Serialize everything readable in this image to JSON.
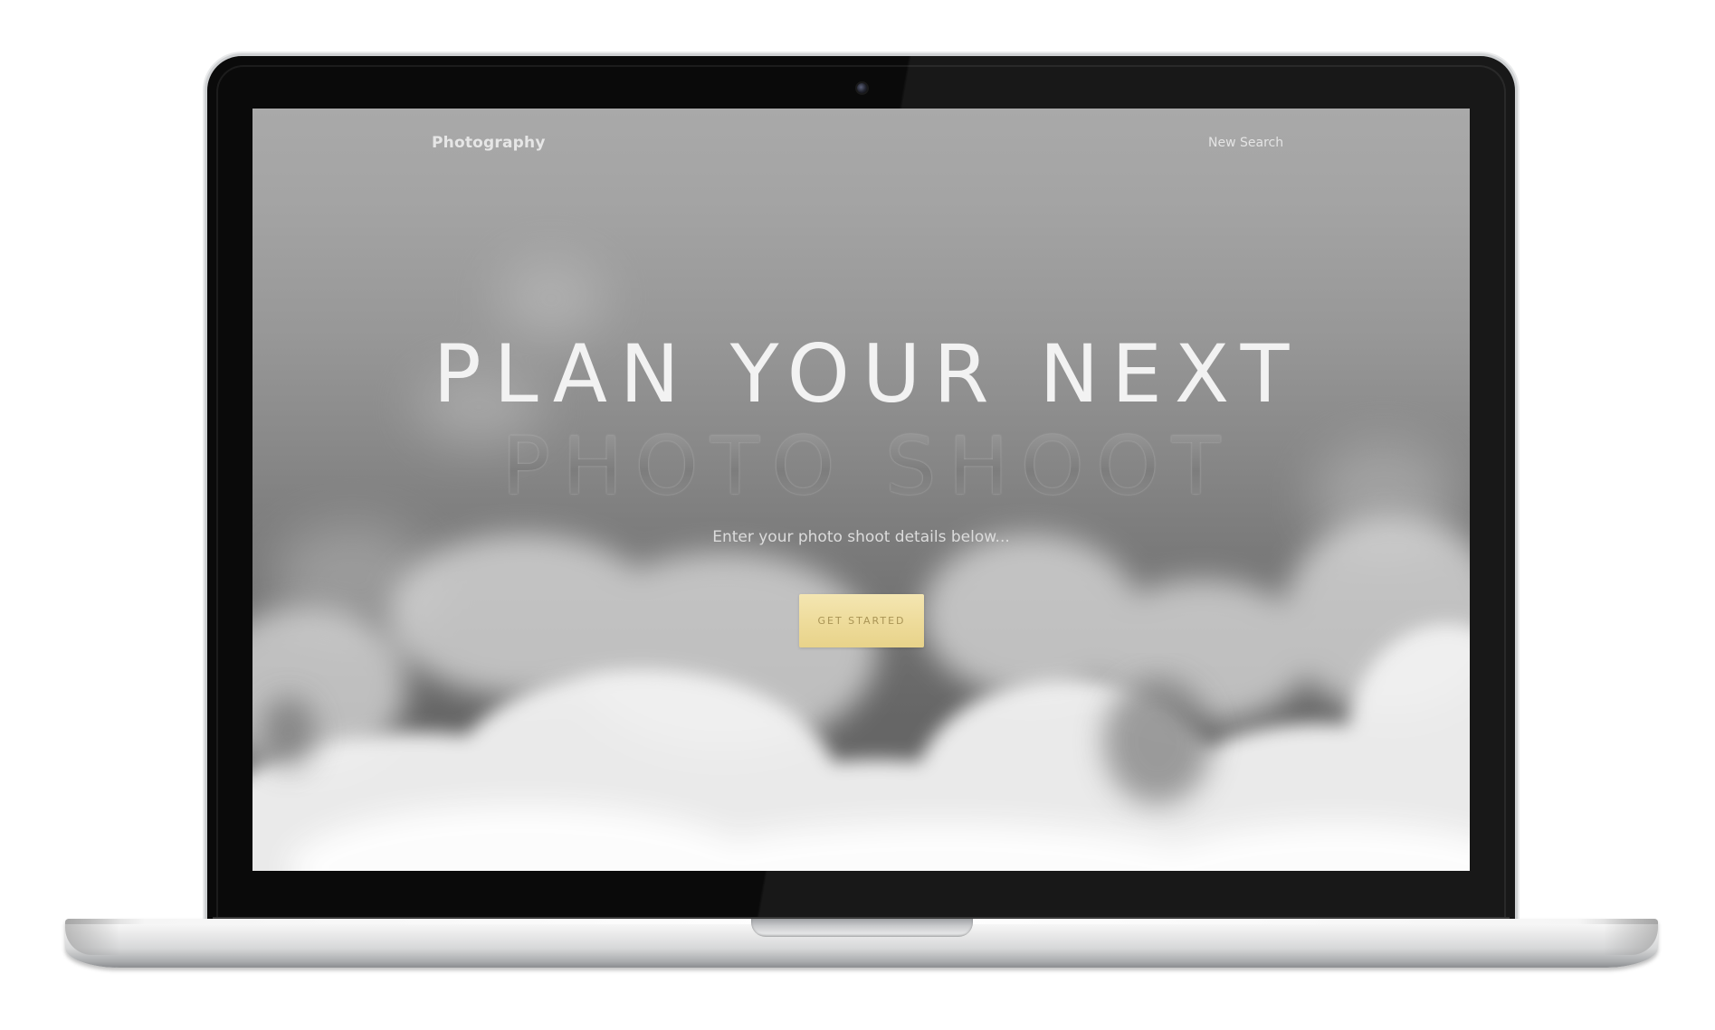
{
  "nav": {
    "brand": "Photography",
    "link": "New Search"
  },
  "hero": {
    "line1": "PLAN YOUR NEXT",
    "line2": "PHOTO SHOOT",
    "subtitle": "Enter your photo shoot details below...",
    "cta_label": "GET STARTED"
  },
  "colors": {
    "cta_background": "#eedc9c",
    "cta_text": "#a99455",
    "sky_top": "#a9a9a9",
    "sky_bottom": "#666666"
  },
  "icons": {
    "camera": "webcam-icon"
  }
}
